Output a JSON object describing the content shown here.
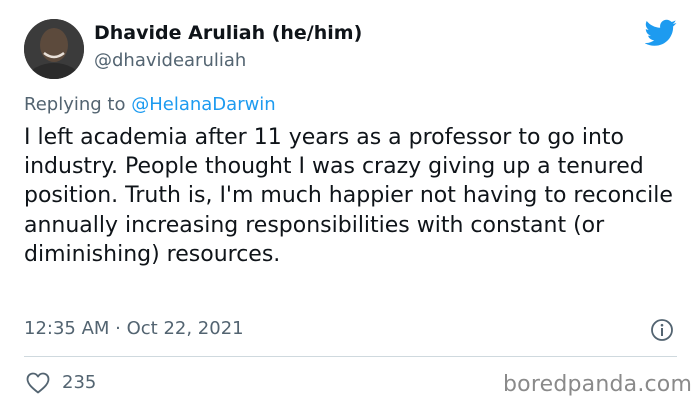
{
  "author": {
    "name": "Dhavide Aruliah (he/him)",
    "handle": "@dhavidearuliah"
  },
  "reply": {
    "prefix": "Replying to",
    "mention": "@HelanaDarwin"
  },
  "tweet": {
    "text": "I left academia after 11 years as a professor to go into industry. People thought I was crazy giving up a tenured position. Truth is, I'm much happier not having to reconcile annually increasing responsibilities with constant (or diminishing) resources.",
    "timestamp": "12:35 AM · Oct 22, 2021"
  },
  "stats": {
    "likes": "235"
  },
  "watermark": "boredpanda.com",
  "icons": {
    "logo": "twitter-bird-icon",
    "info": "info-icon",
    "like": "heart-icon"
  },
  "colors": {
    "accent": "#1d9bf0",
    "text": "#0f1419",
    "secondary": "#536471"
  }
}
